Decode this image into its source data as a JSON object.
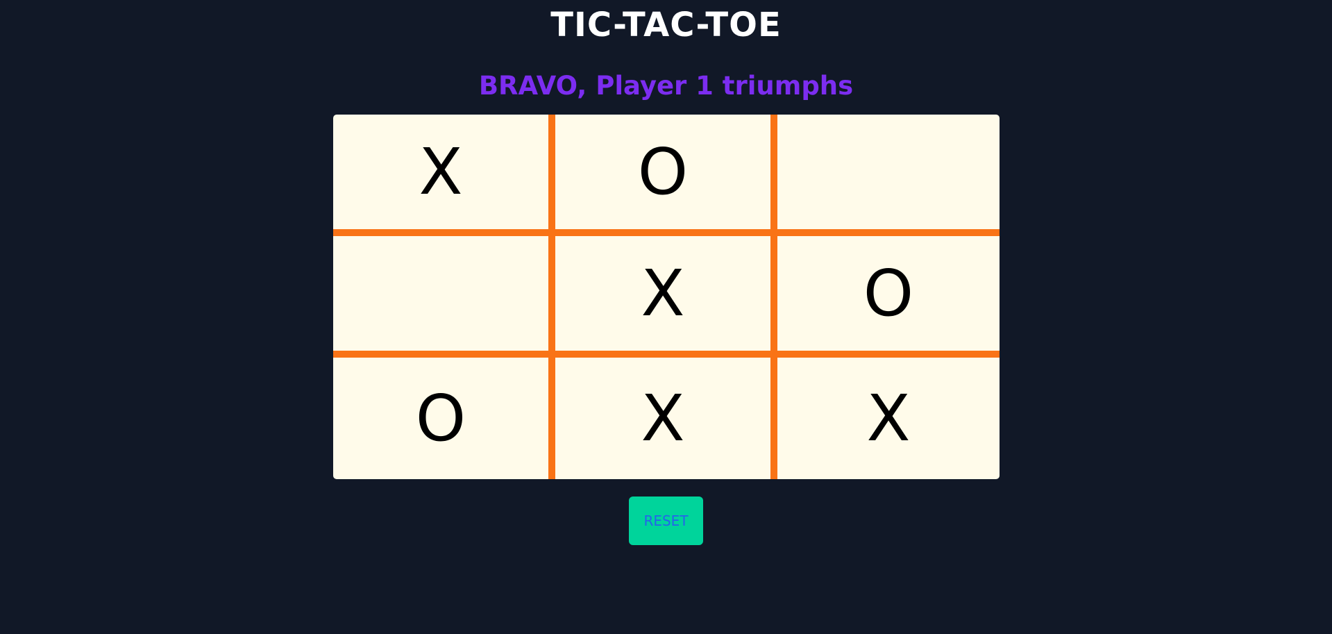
{
  "header": {
    "title": "TIC-TAC-TOE",
    "status": "BRAVO, Player 1 triumphs"
  },
  "board": {
    "cells": [
      [
        "X",
        "O",
        ""
      ],
      [
        "",
        "X",
        "O"
      ],
      [
        "O",
        "X",
        "X"
      ]
    ]
  },
  "controls": {
    "reset_label": "RESET"
  },
  "colors": {
    "background": "#111827",
    "title": "#ffffff",
    "status": "#7c2df0",
    "board": "#fffbea",
    "grid_lines": "#f97316",
    "reset_button": "#00d49b",
    "reset_text": "#2563eb"
  }
}
